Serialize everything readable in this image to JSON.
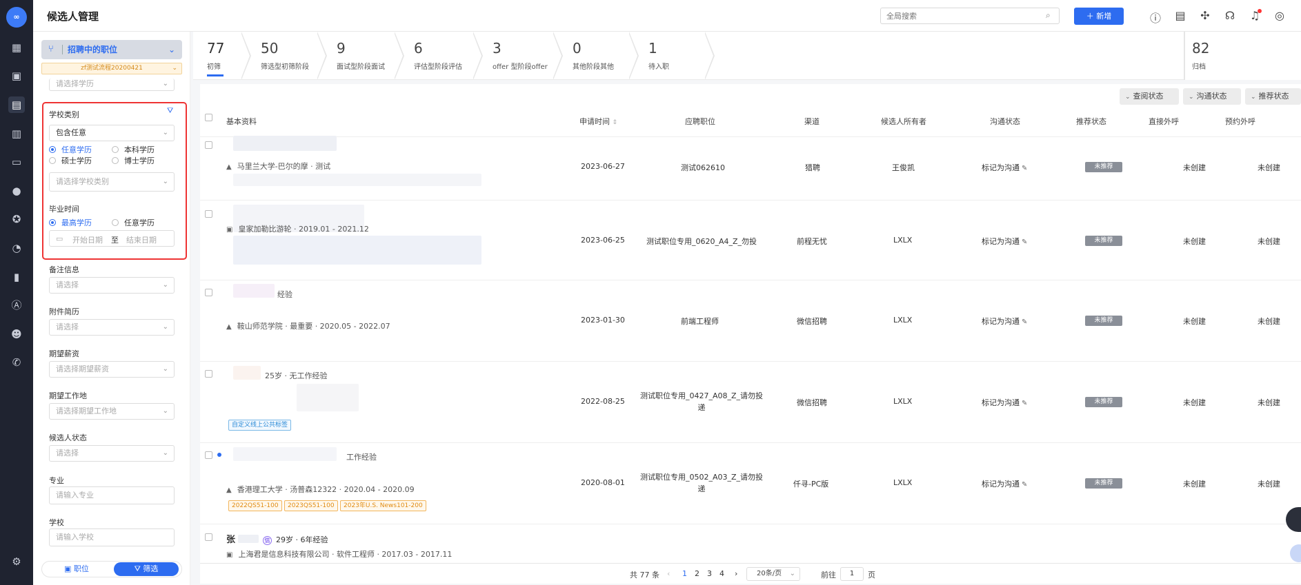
{
  "rail": {
    "logo": "∞",
    "icons": [
      "dashboard-icon",
      "briefcase-icon",
      "candidate-icon",
      "calendar-icon",
      "id-card-icon",
      "wechat-icon",
      "star-icon",
      "pie-chart-icon",
      "bar-chart-icon",
      "talent-icon",
      "user-group-icon",
      "phone-icon",
      "settings-icon"
    ]
  },
  "header": {
    "title": "候选人管理",
    "search_placeholder": "全局搜索",
    "new_label": "＋ 新增"
  },
  "filter": {
    "position_select": "招聘中的职位",
    "flow_tag": "zf测试流程20200421",
    "edu_placeholder_top": "请选择学历",
    "school_type": {
      "label": "学校类别",
      "include_value": "包含任意",
      "degree_options": [
        "任意学历",
        "本科学历",
        "硕士学历",
        "博士学历"
      ],
      "school_placeholder": "请选择学校类别"
    },
    "graduation": {
      "label": "毕业时间",
      "options": [
        "最高学历",
        "任意学历"
      ],
      "start_placeholder": "开始日期",
      "sep": "至",
      "end_placeholder": "结束日期"
    },
    "fields": [
      {
        "label": "备注信息",
        "placeholder": "请选择"
      },
      {
        "label": "附件简历",
        "placeholder": "请选择"
      },
      {
        "label": "期望薪资",
        "placeholder": "请选择期望薪资"
      },
      {
        "label": "期望工作地",
        "placeholder": "请选择期望工作地"
      },
      {
        "label": "候选人状态",
        "placeholder": "请选择"
      },
      {
        "label": "专业",
        "placeholder": "请输入专业"
      },
      {
        "label": "学校",
        "placeholder": "请输入学校"
      }
    ],
    "bottom": {
      "position_btn": "职位",
      "filter_btn": "筛选"
    }
  },
  "stages": [
    {
      "num": "77",
      "label": "初筛"
    },
    {
      "num": "50",
      "label": "筛选型初筛阶段"
    },
    {
      "num": "9",
      "label": "面试型阶段面试"
    },
    {
      "num": "6",
      "label": "评估型阶段评估"
    },
    {
      "num": "3",
      "label": "offer 型阶段offer"
    },
    {
      "num": "0",
      "label": "其他阶段其他"
    },
    {
      "num": "1",
      "label": "待入职"
    }
  ],
  "archive": {
    "num": "82",
    "label": "归档"
  },
  "chips": [
    "查阅状态",
    "沟通状态",
    "推荐状态"
  ],
  "columns": [
    "基本资料",
    "申请时间",
    "应聘职位",
    "渠道",
    "候选人所有者",
    "沟通状态",
    "推荐状态",
    "直接外呼",
    "预约外呼"
  ],
  "rows": [
    {
      "info_line1": "",
      "info_line2": "马里兰大学-巴尔的摩 · 测试",
      "date": "2023-06-27",
      "position": "测试062610",
      "channel": "猎聘",
      "owner": "王俊凯",
      "comm": "标记为沟通",
      "rec": "未推荐",
      "call": "未创建",
      "book": "未创建"
    },
    {
      "info_line1": "皇家加勒比游轮 · 2019.01 - 2021.12",
      "info_line2": "",
      "date": "2023-06-25",
      "position": "测试职位专用_0620_A4_Z_勿投",
      "channel": "前程无忧",
      "owner": "LXLX",
      "comm": "标记为沟通",
      "rec": "未推荐",
      "call": "未创建",
      "book": "未创建"
    },
    {
      "info_line1": "经验",
      "info_line2": "鞍山师范学院 · 最重要 · 2020.05 - 2022.07",
      "date": "2023-01-30",
      "position": "前端工程师",
      "channel": "微信招聘",
      "owner": "LXLX",
      "comm": "标记为沟通",
      "rec": "未推荐",
      "call": "未创建",
      "book": "未创建"
    },
    {
      "info_line1": "25岁 · 无工作经验",
      "info_line2": "",
      "tags": [
        "自定义线上公共标签"
      ],
      "date": "2022-08-25",
      "position": "测试职位专用_0427_A08_Z_请勿投递",
      "channel": "微信招聘",
      "owner": "LXLX",
      "comm": "标记为沟通",
      "rec": "未推荐",
      "call": "未创建",
      "book": "未创建"
    },
    {
      "info_line1": "工作经验",
      "info_line2": "香港理工大学 · 汤普森12322 · 2020.04 - 2020.09",
      "tags": [
        "2022QS51-100",
        "2023QS51-100",
        "2023年U.S. News101-200"
      ],
      "date": "2020-08-01",
      "position": "测试职位专用_0502_A03_Z_请勿投递",
      "channel": "仟寻-PC版",
      "owner": "LXLX",
      "comm": "标记为沟通",
      "rec": "未推荐",
      "call": "未创建",
      "book": "未创建"
    },
    {
      "name": "张",
      "age": "29岁 · 6年经验",
      "info_line2": "上海君是信息科技有限公司 · 软件工程师 · 2017.03 - 2017.11"
    }
  ],
  "pager": {
    "total": "共 77 条",
    "pages": [
      "1",
      "2",
      "3",
      "4"
    ],
    "size": "20条/页",
    "goto_label": "前往",
    "goto_value": "1",
    "page_suffix": "页"
  }
}
